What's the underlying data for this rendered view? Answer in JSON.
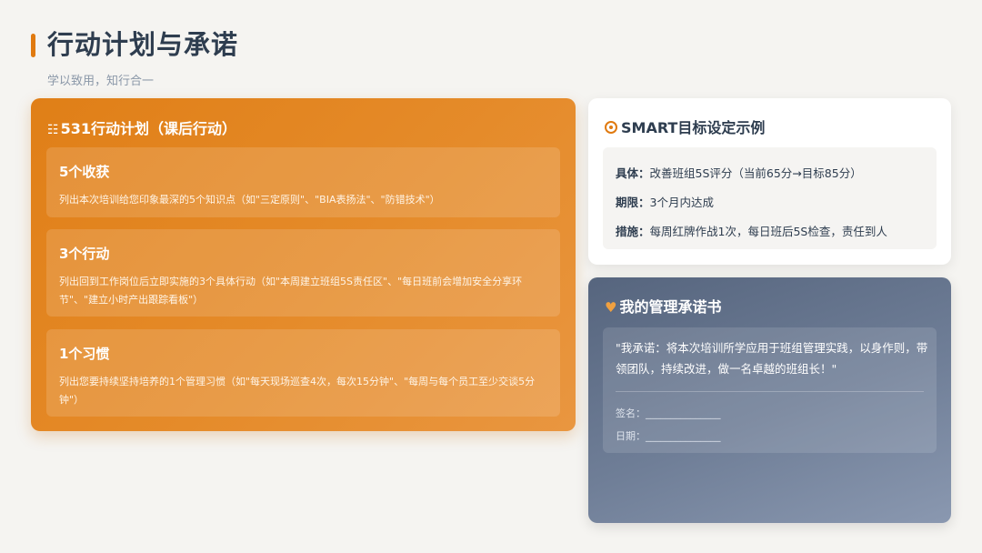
{
  "header": {
    "title": "行动计划与承诺",
    "subtitle": "学以致用，知行合一"
  },
  "plan": {
    "icon": "list-icon",
    "title": "531行动计划（课后行动）",
    "items": [
      {
        "title": "5个收获",
        "desc": "列出本次培训给您印象最深的5个知识点（如\"三定原则\"、\"BIA表扬法\"、\"防错技术\"）"
      },
      {
        "title": "3个行动",
        "desc": "列出回到工作岗位后立即实施的3个具体行动（如\"本周建立班组5S责任区\"、\"每日班前会增加安全分享环节\"、\"建立小时产出跟踪看板\"）"
      },
      {
        "title": "1个习惯",
        "desc": "列出您要持续坚持培养的1个管理习惯（如\"每天现场巡查4次，每次15分钟\"、\"每周与每个员工至少交谈5分钟\"）"
      }
    ]
  },
  "smart": {
    "icon": "target-icon",
    "title": "SMART目标设定示例",
    "rows": [
      {
        "label": "具体：",
        "value": "改善班组5S评分（当前65分→目标85分）"
      },
      {
        "label": "期限：",
        "value": "3个月内达成"
      },
      {
        "label": "措施：",
        "value": "每周红牌作战1次，每日班后5S检查，责任到人"
      }
    ]
  },
  "commitment": {
    "icon": "hand-heart-icon",
    "title": "我的管理承诺书",
    "text": "\"我承诺：将本次培训所学应用于班组管理实践，以身作则，带领团队，持续改进，做一名卓越的班组长！\"",
    "signature_label": "签名：",
    "date_label": "日期：",
    "blank": "_______________"
  },
  "colors": {
    "accent": "#e07a10",
    "plan_card": "#e58b2a",
    "commit_card": "#6f7e97",
    "title_text": "#2e3d4f"
  }
}
